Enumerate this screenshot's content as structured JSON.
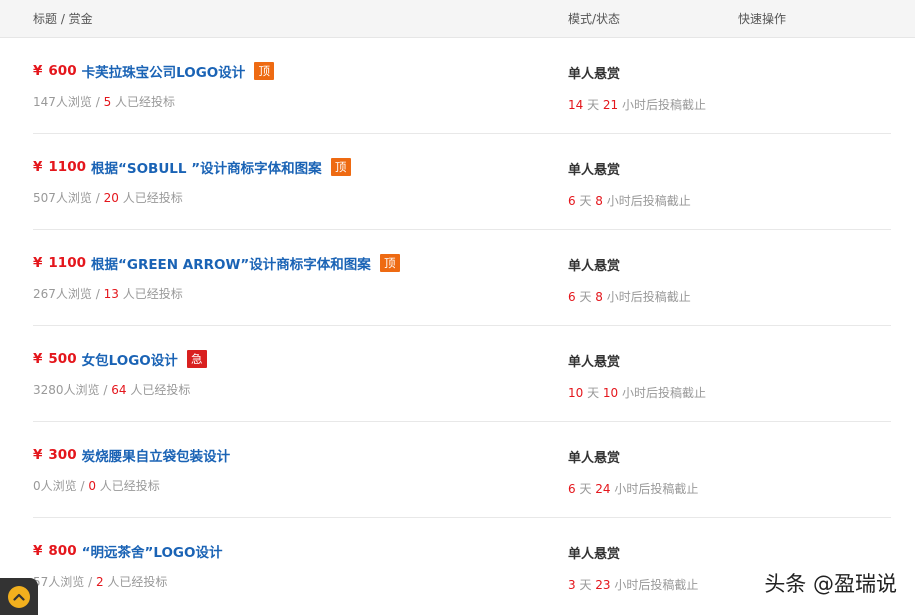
{
  "header": {
    "title_col": "标题 / 赏金",
    "mode_col": "模式/状态",
    "ops_col": "快速操作"
  },
  "rows": [
    {
      "currency": "¥",
      "price": "600",
      "title": "卡芙拉珠宝公司LOGO设计",
      "badge": "顶",
      "badge_type": "top",
      "views": "147",
      "views_suffix": "人浏览",
      "sep": " / ",
      "bids": "5",
      "bids_suffix": " 人已经投标",
      "mode": "单人悬赏",
      "days": "14",
      "days_unit": " 天 ",
      "hours": "21",
      "hours_suffix": " 小时后投稿截止"
    },
    {
      "currency": "¥",
      "price": "1100",
      "title": "根据“SOBULL ”设计商标字体和图案",
      "badge": "顶",
      "badge_type": "top",
      "views": "507",
      "views_suffix": "人浏览",
      "sep": " / ",
      "bids": "20",
      "bids_suffix": " 人已经投标",
      "mode": "单人悬赏",
      "days": "6",
      "days_unit": " 天 ",
      "hours": "8",
      "hours_suffix": " 小时后投稿截止"
    },
    {
      "currency": "¥",
      "price": "1100",
      "title": "根据“GREEN ARROW”设计商标字体和图案",
      "badge": "顶",
      "badge_type": "top",
      "views": "267",
      "views_suffix": "人浏览",
      "sep": " / ",
      "bids": "13",
      "bids_suffix": " 人已经投标",
      "mode": "单人悬赏",
      "days": "6",
      "days_unit": " 天 ",
      "hours": "8",
      "hours_suffix": " 小时后投稿截止"
    },
    {
      "currency": "¥",
      "price": "500",
      "title": "女包LOGO设计",
      "badge": "急",
      "badge_type": "urgent",
      "views": "3280",
      "views_suffix": "人浏览",
      "sep": " / ",
      "bids": "64",
      "bids_suffix": " 人已经投标",
      "mode": "单人悬赏",
      "days": "10",
      "days_unit": " 天 ",
      "hours": "10",
      "hours_suffix": " 小时后投稿截止"
    },
    {
      "currency": "¥",
      "price": "300",
      "title": "炭烧腰果自立袋包装设计",
      "badge": "",
      "badge_type": "",
      "views": "0",
      "views_suffix": "人浏览",
      "sep": " / ",
      "bids": "0",
      "bids_suffix": " 人已经投标",
      "mode": "单人悬赏",
      "days": "6",
      "days_unit": " 天 ",
      "hours": "24",
      "hours_suffix": " 小时后投稿截止"
    },
    {
      "currency": "¥",
      "price": "800",
      "title": "“明远茶舍”LOGO设计",
      "badge": "",
      "badge_type": "",
      "views": "57",
      "views_suffix": "人浏览",
      "sep": " / ",
      "bids": "2",
      "bids_suffix": " 人已经投标",
      "mode": "单人悬赏",
      "days": "3",
      "days_unit": " 天 ",
      "hours": "23",
      "hours_suffix": " 小时后投稿截止"
    }
  ],
  "scroll_top": {
    "icon": "chevron-up-icon"
  },
  "watermark": {
    "text": "头条 @盈瑞说"
  },
  "colors": {
    "price": "#e4161c",
    "link": "#1a63b5",
    "badge_top": "#ee6a12",
    "badge_urgent": "#d9201f"
  }
}
